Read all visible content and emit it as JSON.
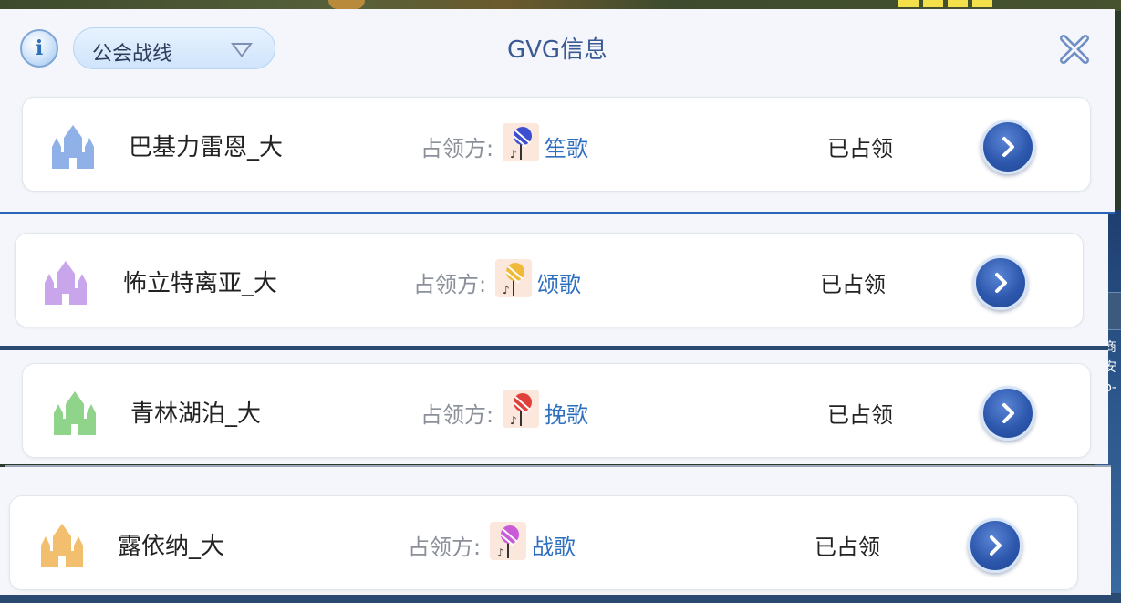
{
  "header": {
    "info_glyph": "i",
    "dropdown_label": "公会战线",
    "title": "GVG信息"
  },
  "rows": [
    {
      "name": "巴基力雷恩_大",
      "occupier_label": "占领方:",
      "guild": "笙歌",
      "status": "已占领",
      "castle_color": "#8fb1e8",
      "guild_ball_color": "#3b4fd0"
    },
    {
      "name": "怖立特离亚_大",
      "occupier_label": "占领方:",
      "guild": "颂歌",
      "status": "已占领",
      "castle_color": "#c9a6ec",
      "guild_ball_color": "#f0b93a"
    },
    {
      "name": "青林湖泊_大",
      "occupier_label": "占领方:",
      "guild": "挽歌",
      "status": "已占领",
      "castle_color": "#8fd48a",
      "guild_ball_color": "#e0413a"
    },
    {
      "name": "露依纳_大",
      "occupier_label": "占领方:",
      "guild": "战歌",
      "status": "已占领",
      "castle_color": "#f2bf6e",
      "guild_ball_color": "#c95ad8"
    }
  ],
  "desktop_text": [
    "商安",
    "p-"
  ],
  "colors": {
    "accent": "#2a63b8",
    "link": "#2f6fc0"
  }
}
